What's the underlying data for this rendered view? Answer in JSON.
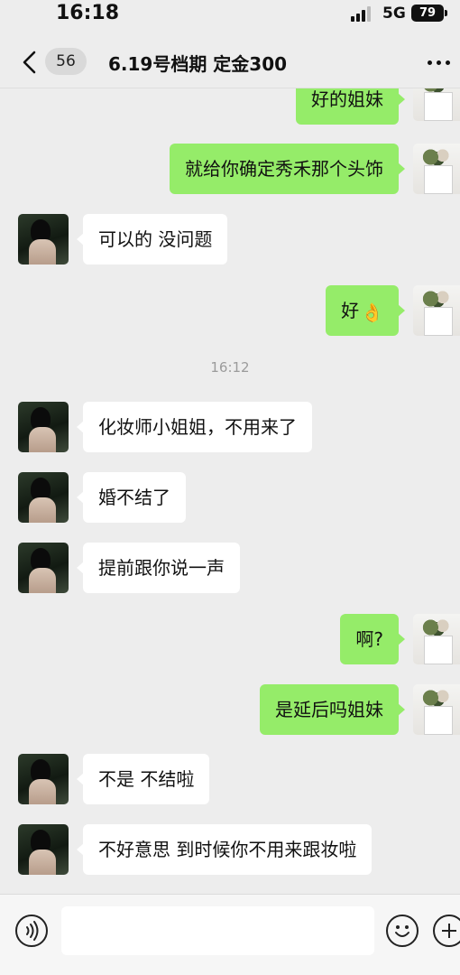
{
  "status_bar": {
    "time": "16:18",
    "network": "5G",
    "battery": "79"
  },
  "header": {
    "unread_count": "56",
    "title": "6.19号档期  定金300",
    "back_icon": "chevron-left-icon",
    "more_icon": "more-horizontal-icon"
  },
  "messages": [
    {
      "side": "right",
      "text": "好的姐妹"
    },
    {
      "side": "right",
      "text": "就给你确定秀禾那个头饰"
    },
    {
      "side": "left",
      "text": "可以的 没问题"
    },
    {
      "side": "right",
      "text": "好",
      "emoji": "👌"
    },
    {
      "side": "left",
      "text": "化妆师小姐姐，不用来了"
    },
    {
      "side": "left",
      "text": "婚不结了"
    },
    {
      "side": "left",
      "text": "提前跟你说一声"
    },
    {
      "side": "right",
      "text": "啊?"
    },
    {
      "side": "right",
      "text": "是延后吗姐妹"
    },
    {
      "side": "left",
      "text": "不是 不结啦"
    },
    {
      "side": "left",
      "text": "不好意思 到时候你不用来跟妆啦"
    }
  ],
  "timestamp": "16:12",
  "input_bar": {
    "voice_icon": "voice-icon",
    "emoji_icon": "smiley-icon",
    "plus_icon": "plus-icon",
    "value": ""
  },
  "colors": {
    "background": "#ededed",
    "bubble_self": "#95ec69",
    "bubble_other": "#ffffff",
    "timestamp_text": "#9b9b9b"
  }
}
